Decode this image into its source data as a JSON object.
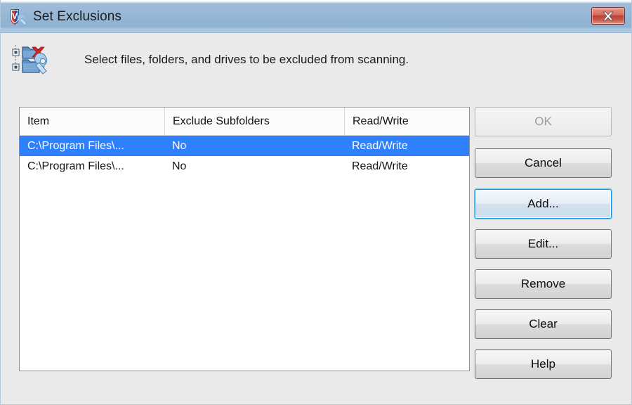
{
  "window": {
    "title": "Set Exclusions",
    "app_icon": "shield-wrench-icon",
    "close_label": "Close"
  },
  "banner": {
    "icon": "folder-exclusion-wrench-icon",
    "description": "Select files, folders, and drives to be excluded from scanning."
  },
  "listview": {
    "columns": [
      {
        "label": "Item"
      },
      {
        "label": "Exclude Subfolders"
      },
      {
        "label": "Read/Write"
      }
    ],
    "rows": [
      {
        "item": "C:\\Program Files\\...",
        "exclude_subfolders": "No",
        "read_write": "Read/Write",
        "selected": true
      },
      {
        "item": "C:\\Program Files\\...",
        "exclude_subfolders": "No",
        "read_write": "Read/Write",
        "selected": false
      }
    ]
  },
  "buttons": {
    "ok": "OK",
    "cancel": "Cancel",
    "add": "Add...",
    "edit": "Edit...",
    "remove": "Remove",
    "clear": "Clear",
    "help": "Help"
  },
  "colors": {
    "titlebar_blue": "#8fb2d2",
    "selection_blue": "#2f80fc",
    "focus_blue": "#1e9ade",
    "close_red": "#bb4133",
    "body_background": "#eaeaea"
  }
}
